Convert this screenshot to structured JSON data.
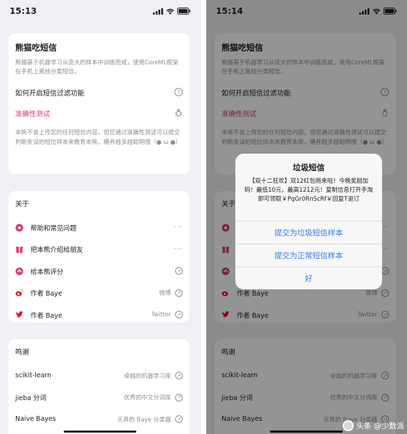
{
  "left": {
    "status_time": "15:13",
    "app": {
      "title": "熊猫吃短信",
      "description": "熊猫基于机器学习从庞大的样本中训练而成，使用CoreML框架在手机上离线分类短信。",
      "how_to_enable": "如何开启短信过滤功能",
      "accuracy_test": "准确性测试",
      "privacy_note": "本熊不会上传您的任何短信内容，但您通过准确性测试可以提交判断失误的短信样本来教育本熊，嚼养越多越聪明哦（● ω ●）"
    },
    "about": {
      "title": "关于",
      "items": [
        {
          "label": "帮助和常见问题",
          "sub": ""
        },
        {
          "label": "把本熊介绍给朋友",
          "sub": ""
        },
        {
          "label": "给本熊评分",
          "sub": ""
        },
        {
          "label": "作者 Baye",
          "sub": "微博"
        },
        {
          "label": "作者 Baye",
          "sub": "Twitter"
        }
      ]
    },
    "thanks": {
      "title": "鸣谢",
      "items": [
        {
          "label": "scikit-learn",
          "sub": "卓越的机器学习库"
        },
        {
          "label": "jieba 分词",
          "sub": "优秀的中文分词库"
        },
        {
          "label": "Naive Bayes",
          "sub": "天真的 Baye 分类器"
        }
      ]
    }
  },
  "right": {
    "status_time": "15:14",
    "alert": {
      "title": "垃圾短信",
      "message": "【双十二狂欢】双12红包雨来啦！今晚奖励加码！最低10元，最高1212元！复制信息打开手淘即可领取￥PqGr0RnScRf￥回复T退订",
      "buttons": [
        "提交为垃圾短信样本",
        "提交为正常短信样本",
        "好"
      ]
    }
  },
  "watermark": "头条 @少数派",
  "colors": {
    "accent_pink": "#d0426b",
    "ios_blue": "#2f7cf6",
    "twitter_blue": "#1da1f2",
    "weibo_red": "#e6162d"
  }
}
